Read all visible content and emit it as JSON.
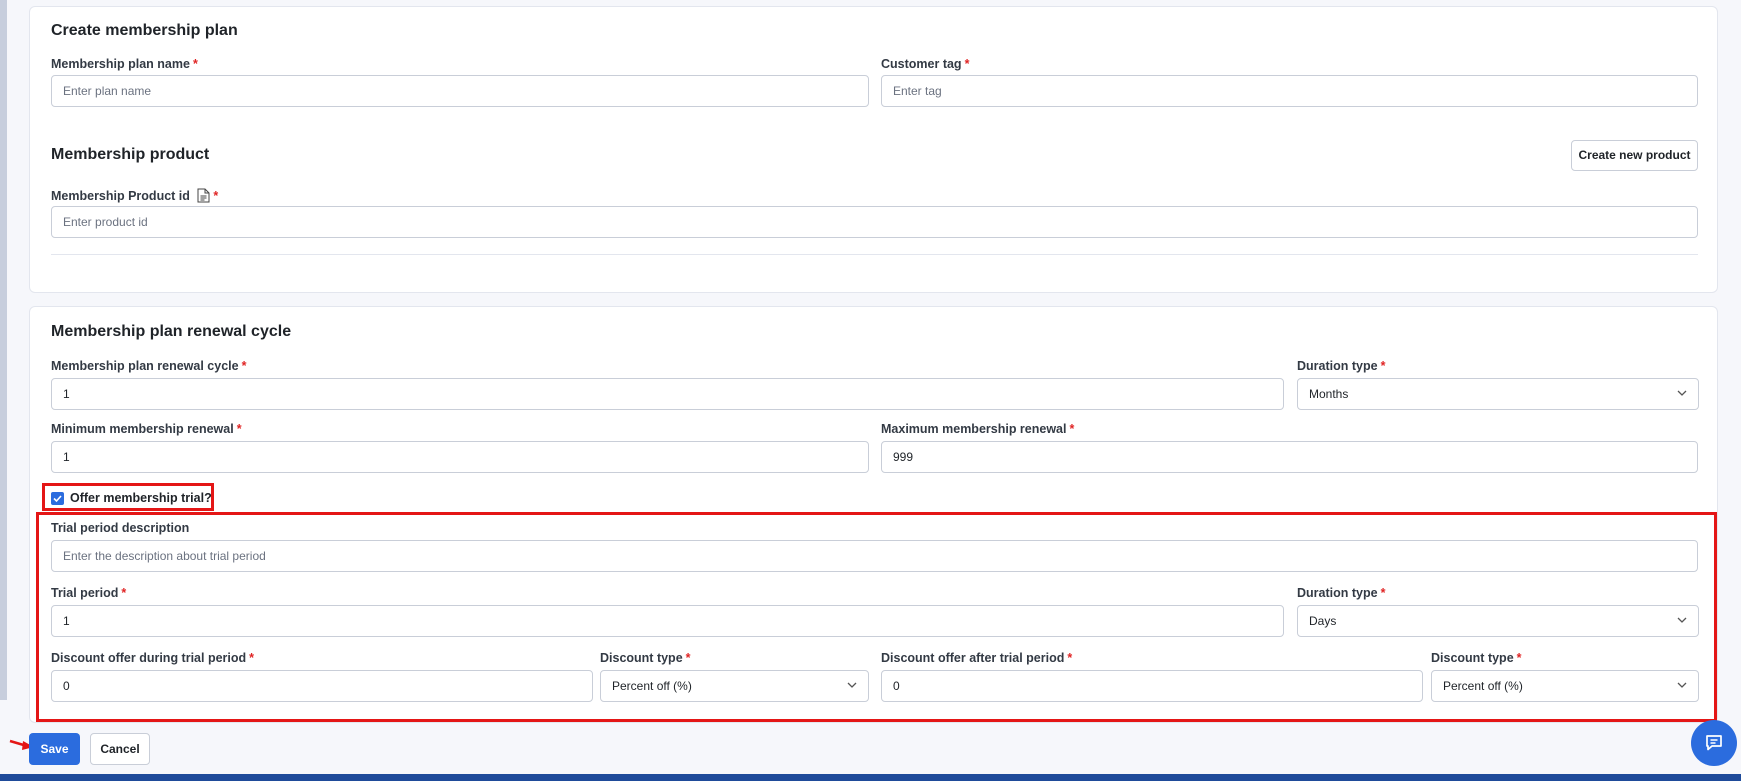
{
  "plan_section": {
    "title": "Create membership plan",
    "plan_name": {
      "label": "Membership plan name",
      "required": "*",
      "placeholder": "Enter plan name"
    },
    "customer_tag": {
      "label": "Customer tag",
      "required": "*",
      "placeholder": "Enter tag"
    }
  },
  "product_section": {
    "title": "Membership product",
    "create_button": "Create new product",
    "product_id": {
      "label": "Membership Product id",
      "required": "*",
      "placeholder": "Enter product id"
    }
  },
  "renewal_section": {
    "title": "Membership plan renewal cycle",
    "renewal_cycle": {
      "label": "Membership plan renewal cycle",
      "required": "*",
      "value": "1"
    },
    "duration_type": {
      "label": "Duration type",
      "required": "*",
      "value": "Months"
    },
    "min_renewal": {
      "label": "Minimum membership renewal",
      "required": "*",
      "value": "1"
    },
    "max_renewal": {
      "label": "Maximum membership renewal",
      "required": "*",
      "value": "999"
    },
    "offer_trial": {
      "label": "Offer membership trial?",
      "checked": true
    }
  },
  "trial_section": {
    "description": {
      "label": "Trial period description",
      "placeholder": "Enter the description about trial period"
    },
    "trial_period": {
      "label": "Trial period",
      "required": "*",
      "value": "1"
    },
    "duration_type": {
      "label": "Duration type",
      "required": "*",
      "value": "Days"
    },
    "discount_during": {
      "label": "Discount offer during trial period",
      "required": "*",
      "value": "0"
    },
    "discount_type_during": {
      "label": "Discount type",
      "required": "*",
      "value": "Percent off (%)"
    },
    "discount_after": {
      "label": "Discount offer after trial period",
      "required": "*",
      "value": "0"
    },
    "discount_type_after": {
      "label": "Discount type",
      "required": "*",
      "value": "Percent off (%)"
    }
  },
  "actions": {
    "save": "Save",
    "cancel": "Cancel"
  },
  "icons": {
    "document": "document-icon",
    "chevron": "chevron-down-icon",
    "chat": "chat-icon",
    "check": "check-icon"
  },
  "colors": {
    "primary": "#2b6cde",
    "highlight": "#e41616",
    "required": "#e02424",
    "footer": "#1f4b9a"
  }
}
